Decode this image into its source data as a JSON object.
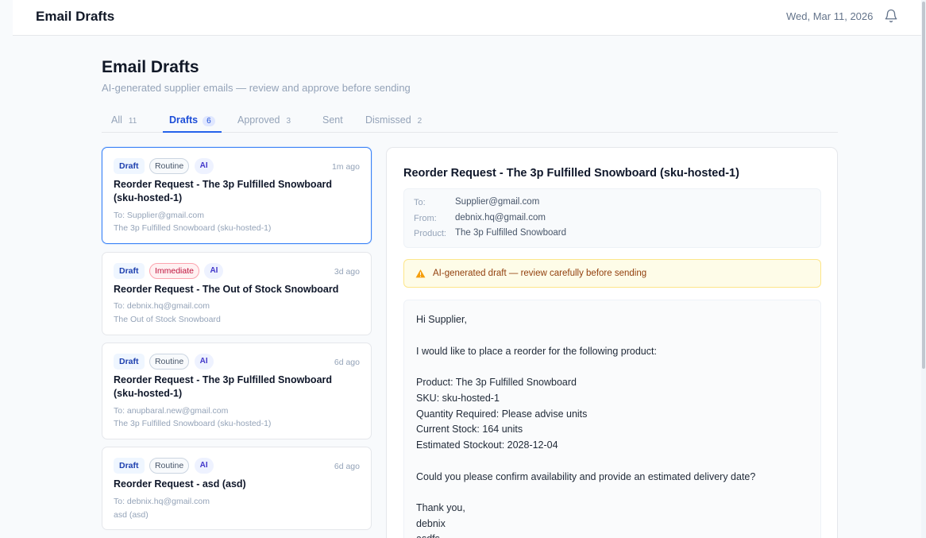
{
  "header": {
    "app_title": "Email Drafts",
    "date": "Wed, Mar 11, 2026",
    "notification_icon": "bell-icon"
  },
  "page": {
    "title": "Email Drafts",
    "subtitle": "AI-generated supplier emails — review and approve before sending"
  },
  "tabs": [
    {
      "label": "All",
      "count": "11"
    },
    {
      "label": "Drafts",
      "count": "6",
      "active": true
    },
    {
      "label": "Approved",
      "count": "3"
    },
    {
      "label": "Sent",
      "count": ""
    },
    {
      "label": "Dismissed",
      "count": "2"
    }
  ],
  "drafts": [
    {
      "status": "Draft",
      "priority": "Routine",
      "ai": "AI",
      "time": "1m ago",
      "title": "Reorder Request - The 3p Fulfilled Snowboard (sku-hosted-1)",
      "to": "To: Supplier@gmail.com",
      "product": "The 3p Fulfilled Snowboard (sku-hosted-1)",
      "selected": true
    },
    {
      "status": "Draft",
      "priority": "Immediate",
      "ai": "AI",
      "time": "3d ago",
      "title": "Reorder Request - The Out of Stock Snowboard",
      "to": "To: debnix.hq@gmail.com",
      "product": "The Out of Stock Snowboard"
    },
    {
      "status": "Draft",
      "priority": "Routine",
      "ai": "AI",
      "time": "6d ago",
      "title": "Reorder Request - The 3p Fulfilled Snowboard (sku-hosted-1)",
      "to": "To: anupbaral.new@gmail.com",
      "product": "The 3p Fulfilled Snowboard (sku-hosted-1)"
    },
    {
      "status": "Draft",
      "priority": "Routine",
      "ai": "AI",
      "time": "6d ago",
      "title": "Reorder Request - asd (asd)",
      "to": "To: debnix.hq@gmail.com",
      "product": "asd (asd)"
    }
  ],
  "detail": {
    "title": "Reorder Request - The 3p Fulfilled Snowboard (sku-hosted-1)",
    "meta": {
      "to_label": "To:",
      "to": "Supplier@gmail.com",
      "from_label": "From:",
      "from": "debnix.hq@gmail.com",
      "product_label": "Product:",
      "product": "The 3p Fulfilled Snowboard"
    },
    "warning": "AI-generated draft — review carefully before sending",
    "body": {
      "greeting": "Hi Supplier,",
      "intro": "I would like to place a reorder for the following product:",
      "product": "Product: The 3p Fulfilled Snowboard",
      "sku": "SKU: sku-hosted-1",
      "quantity": "Quantity Required: Please advise units",
      "stock": "Current Stock: 164 units",
      "stockout": "Estimated Stockout: 2028-12-04",
      "question": "Could you please confirm availability and provide an estimated delivery date?",
      "closing": "Thank you,",
      "signature": "debnix",
      "extra": "asdfs"
    }
  }
}
